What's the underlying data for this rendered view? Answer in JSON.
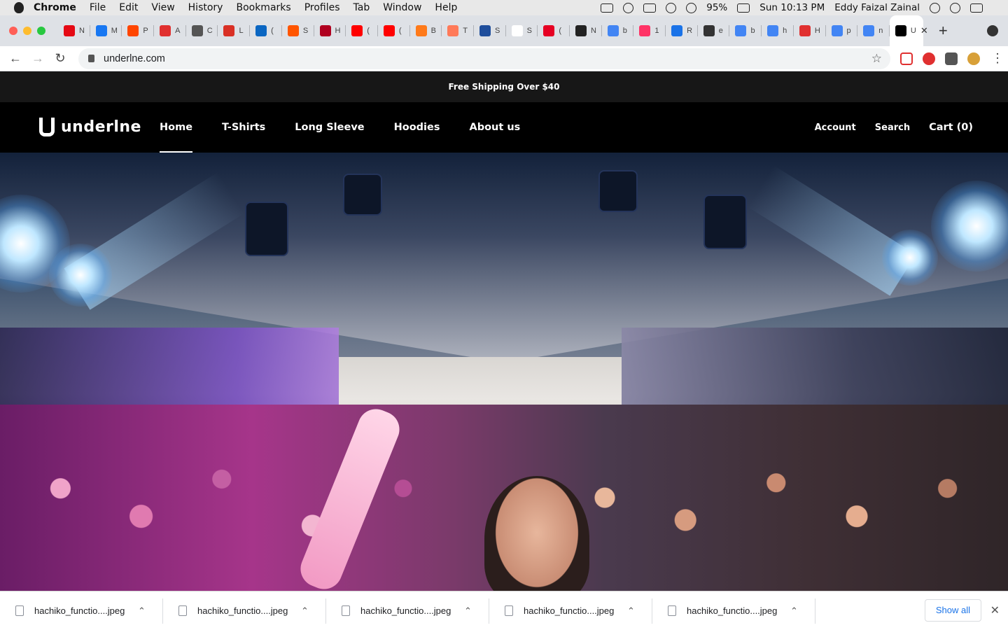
{
  "menubar": {
    "app": "Chrome",
    "items": [
      "File",
      "Edit",
      "View",
      "History",
      "Bookmarks",
      "Profiles",
      "Tab",
      "Window",
      "Help"
    ],
    "battery": "95%",
    "clock": "Sun 10:13 PM",
    "user": "Eddy Faizal Zainal"
  },
  "tabs": [
    {
      "label": "N",
      "icon": "netflix-icon",
      "color": "#e50914"
    },
    {
      "label": "M",
      "icon": "facebook-icon",
      "color": "#1877f2"
    },
    {
      "label": "P",
      "icon": "reddit-icon",
      "color": "#ff4500"
    },
    {
      "label": "A",
      "icon": "app-icon",
      "color": "#e03030"
    },
    {
      "label": "C",
      "icon": "chrome-icon",
      "color": "#555555"
    },
    {
      "label": "L",
      "icon": "gmail-icon",
      "color": "#d93025"
    },
    {
      "label": "(",
      "icon": "linkedin-icon",
      "color": "#0a66c2"
    },
    {
      "label": "S",
      "icon": "soundcloud-icon",
      "color": "#ff5500"
    },
    {
      "label": "H",
      "icon": "hbr-icon",
      "color": "#b00020"
    },
    {
      "label": "(",
      "icon": "youtube-icon",
      "color": "#ff0000"
    },
    {
      "label": "(",
      "icon": "youtube-icon",
      "color": "#ff0000"
    },
    {
      "label": "B",
      "icon": "dash-icon",
      "color": "#ff7a1a"
    },
    {
      "label": "T",
      "icon": "audio-icon",
      "color": "#ff7a59"
    },
    {
      "label": "S",
      "icon": "mr-icon",
      "color": "#1f4e9c"
    },
    {
      "label": "S",
      "icon": "blank-icon",
      "color": "#ffffff"
    },
    {
      "label": "(",
      "icon": "pinterest-icon",
      "color": "#e60023"
    },
    {
      "label": "N",
      "icon": "qr-icon",
      "color": "#222222"
    },
    {
      "label": "b",
      "icon": "google-icon",
      "color": "#4285f4"
    },
    {
      "label": "1",
      "icon": "invision-icon",
      "color": "#ff3366"
    },
    {
      "label": "R",
      "icon": "info-icon",
      "color": "#1a73e8"
    },
    {
      "label": "e",
      "icon": "eye-icon",
      "color": "#333333"
    },
    {
      "label": "b",
      "icon": "google-icon",
      "color": "#4285f4"
    },
    {
      "label": "h",
      "icon": "google-icon",
      "color": "#4285f4"
    },
    {
      "label": "H",
      "icon": "app-icon",
      "color": "#e03030"
    },
    {
      "label": "p",
      "icon": "google-icon",
      "color": "#4285f4"
    },
    {
      "label": "n",
      "icon": "google-icon",
      "color": "#4285f4"
    },
    {
      "label": "U",
      "icon": "underlne-icon",
      "color": "#000000",
      "active": true
    }
  ],
  "toolbar": {
    "url": "underlne.com"
  },
  "site": {
    "announcement": "Free Shipping Over $40",
    "logo": "underlne",
    "nav": [
      "Home",
      "T-Shirts",
      "Long Sleeve",
      "Hoodies",
      "About us"
    ],
    "account": "Account",
    "search": "Search",
    "cart": "Cart (0)"
  },
  "downloads": {
    "files": [
      "hachiko_functio....jpeg",
      "hachiko_functio....jpeg",
      "hachiko_functio....jpeg",
      "hachiko_functio....jpeg",
      "hachiko_functio....jpeg"
    ],
    "show_all": "Show all"
  }
}
